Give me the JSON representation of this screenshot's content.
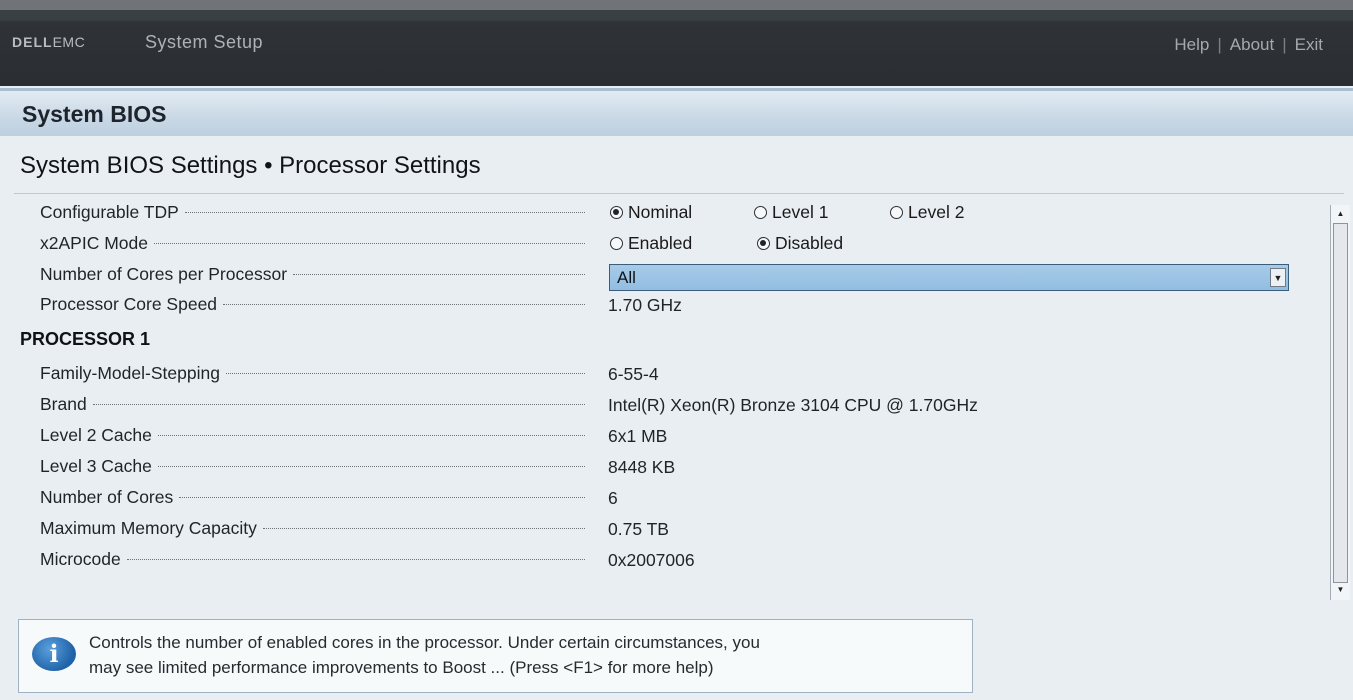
{
  "topbar": {
    "logo_part1": "DELL",
    "logo_part2": "EMC",
    "title": "System Setup",
    "links": {
      "help": "Help",
      "about": "About",
      "exit": "Exit",
      "separator": "|"
    }
  },
  "header": {
    "title": "System BIOS"
  },
  "breadcrumb": "System BIOS Settings • Processor Settings",
  "settings": {
    "tdp": {
      "label": "Configurable TDP",
      "options": [
        "Nominal",
        "Level 1",
        "Level 2"
      ],
      "selected": "Nominal"
    },
    "x2apic": {
      "label": "x2APIC Mode",
      "options": [
        "Enabled",
        "Disabled"
      ],
      "selected": "Disabled"
    },
    "cores_per_proc": {
      "label": "Number of Cores per Processor",
      "value": "All"
    },
    "core_speed": {
      "label": "Processor Core Speed",
      "value": "1.70 GHz"
    }
  },
  "processor1": {
    "title": "PROCESSOR 1",
    "rows": [
      {
        "label": "Family-Model-Stepping",
        "value": "6-55-4"
      },
      {
        "label": "Brand",
        "value": "Intel(R) Xeon(R) Bronze 3104 CPU @ 1.70GHz"
      },
      {
        "label": "Level 2 Cache",
        "value": "6x1 MB"
      },
      {
        "label": "Level 3 Cache",
        "value": "8448 KB"
      },
      {
        "label": "Number of Cores",
        "value": "6"
      },
      {
        "label": "Maximum Memory Capacity",
        "value": "0.75 TB"
      },
      {
        "label": "Microcode",
        "value": "0x2007006"
      }
    ]
  },
  "help": {
    "icon": "info-icon",
    "line1": "Controls the number of enabled cores in the processor. Under certain circumstances, you",
    "line2": "may see limited performance improvements to Boost ... (Press <F1> for more help)"
  },
  "colors": {
    "accent": "#92bde1",
    "topbar": "#2f3337",
    "header": "#c9d8e6"
  }
}
